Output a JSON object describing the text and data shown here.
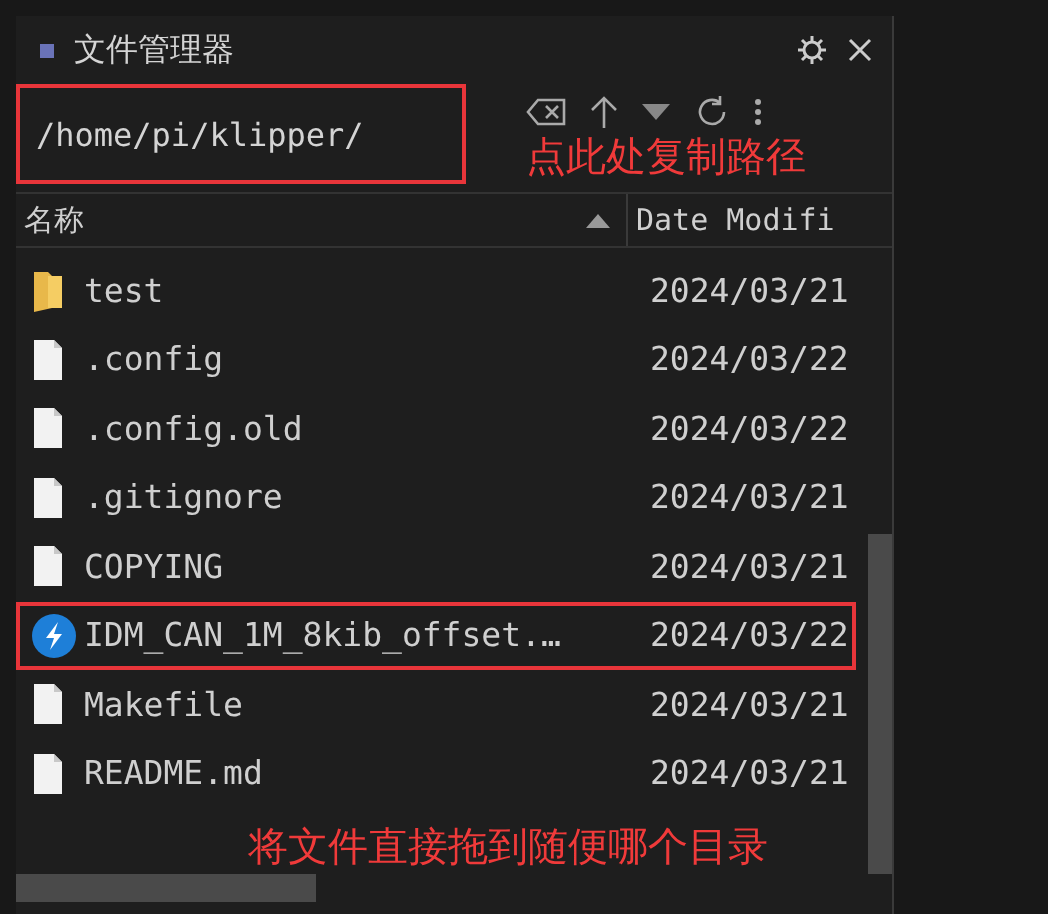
{
  "panel": {
    "title": "文件管理器"
  },
  "path": {
    "value": "/home/pi/klipper/",
    "highlighted": true
  },
  "path_note": "点此处复制路径",
  "columns": [
    {
      "label": "名称",
      "sorted": true
    },
    {
      "label": "Date Modifi",
      "sorted": false
    }
  ],
  "rows": [
    {
      "kind": "folder",
      "name": "test",
      "date": "2024/03/21",
      "highlighted": false
    },
    {
      "kind": "file",
      "name": ".config",
      "date": "2024/03/22",
      "highlighted": false
    },
    {
      "kind": "file",
      "name": ".config.old",
      "date": "2024/03/22",
      "highlighted": false
    },
    {
      "kind": "file",
      "name": ".gitignore",
      "date": "2024/03/21",
      "highlighted": false
    },
    {
      "kind": "file",
      "name": "COPYING",
      "date": "2024/03/21",
      "highlighted": false
    },
    {
      "kind": "app",
      "name": "IDM_CAN_1M_8kib_offset.…",
      "date": "2024/03/22",
      "highlighted": true
    },
    {
      "kind": "file",
      "name": "Makefile",
      "date": "2024/03/21",
      "highlighted": false
    },
    {
      "kind": "file",
      "name": "README.md",
      "date": "2024/03/21",
      "highlighted": false
    }
  ],
  "drop_note": "将文件直接拖到随便哪个目录"
}
